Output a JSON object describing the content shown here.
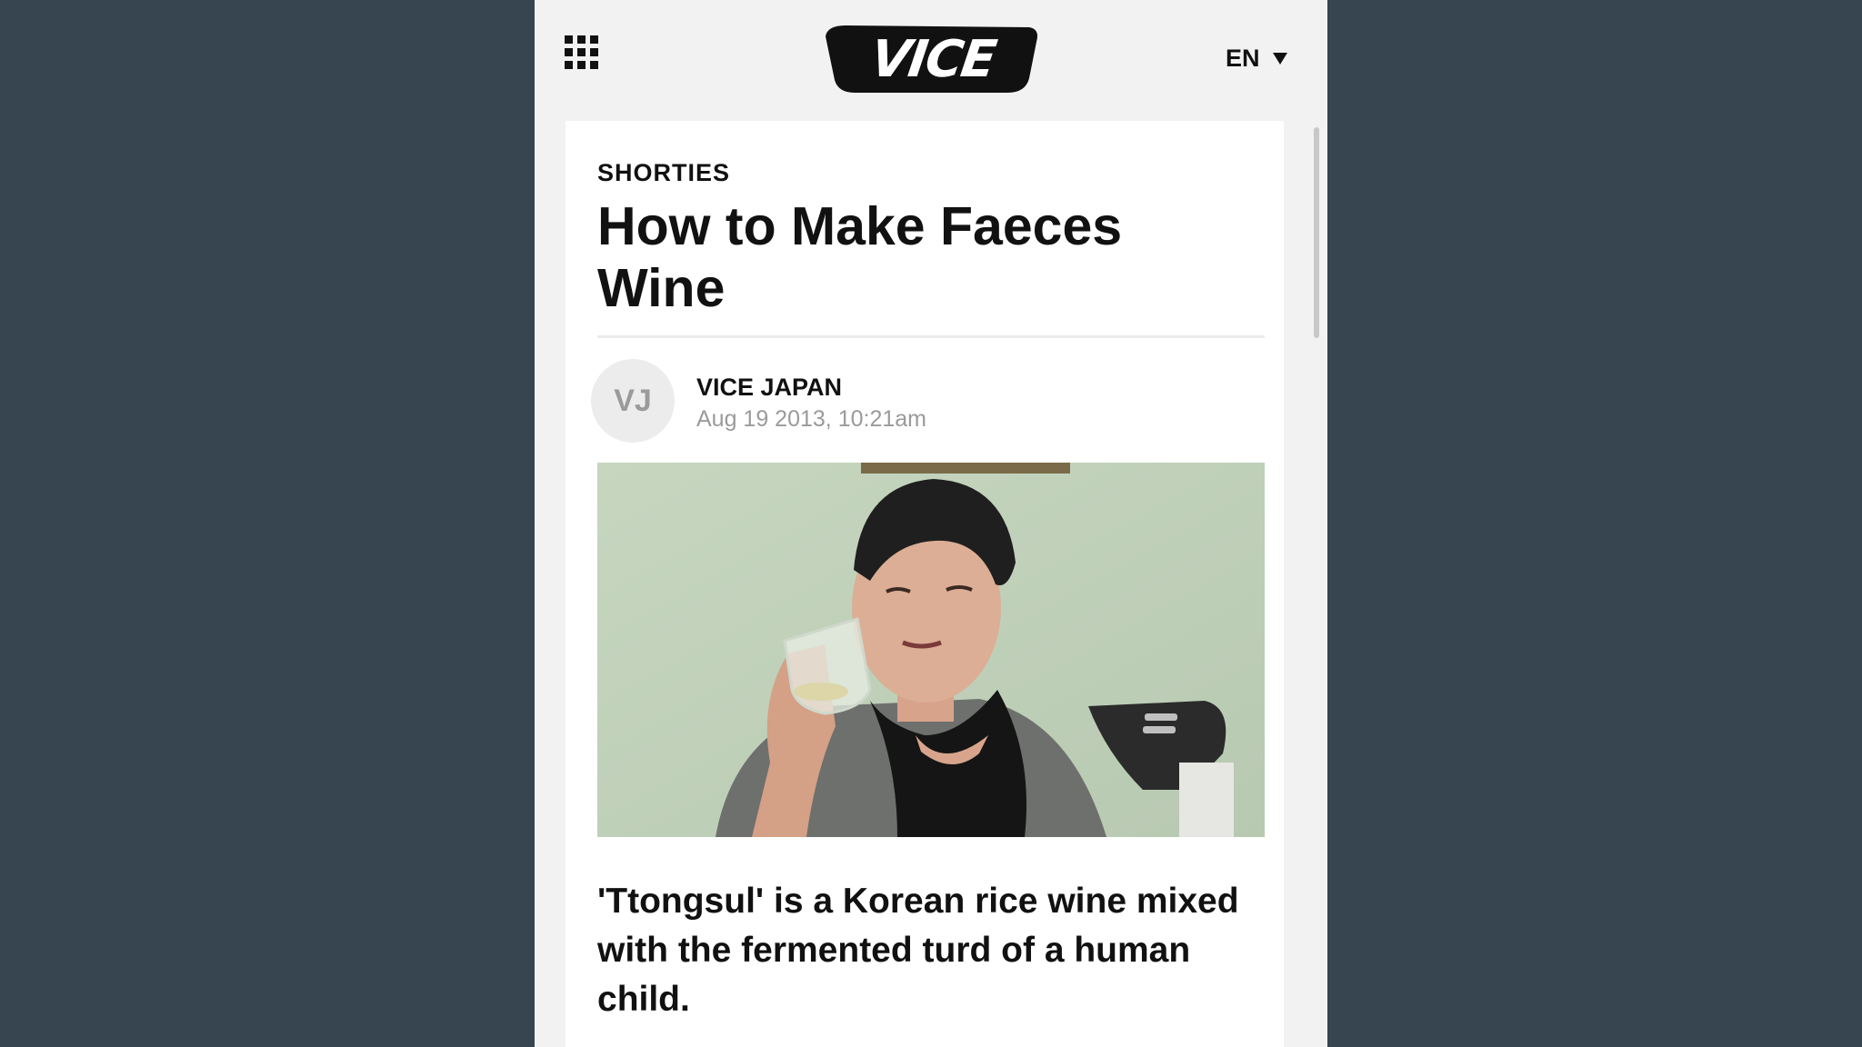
{
  "header": {
    "menu_icon": "grid-menu-icon",
    "logo_text": "VICE",
    "language": "EN",
    "language_caret_icon": "caret-down-icon"
  },
  "article": {
    "category": "SHORTIES",
    "title": "How to Make Faeces Wine",
    "author": {
      "initials": "VJ",
      "name": "VICE JAPAN",
      "date": "Aug 19 2013, 10:21am"
    },
    "image_description": "woman with short dark hair sipping a pale drink from a glass",
    "dek": "'Ttongsul' is a Korean rice wine mixed with the fermented turd of a human child."
  },
  "colors": {
    "background": "#36454f",
    "page": "#f2f2f2",
    "card": "#ffffff",
    "text": "#111111",
    "muted": "#9a9a9a"
  }
}
